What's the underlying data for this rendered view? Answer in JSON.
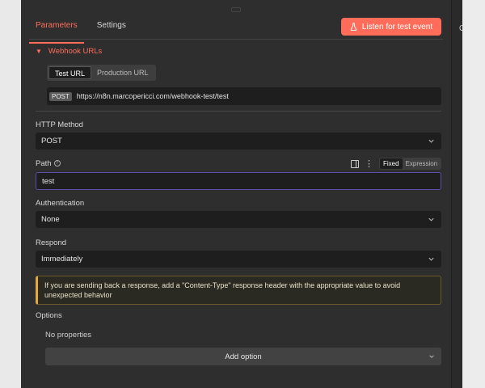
{
  "tabs": [
    "Parameters",
    "Settings"
  ],
  "listen_button": "Listen for test event",
  "webhook": {
    "section_label": "Webhook URLs",
    "url_tabs": [
      "Test URL",
      "Production URL"
    ],
    "method": "POST",
    "url": "https://n8n.marcopericci.com/webhook-test/test"
  },
  "http_method": {
    "label": "HTTP Method",
    "value": "POST"
  },
  "path": {
    "label": "Path",
    "value": "test",
    "modes": [
      "Fixed",
      "Expression"
    ]
  },
  "authentication": {
    "label": "Authentication",
    "value": "None"
  },
  "respond": {
    "label": "Respond",
    "value": "Immediately"
  },
  "notice": "If you are sending back a response, add a \"Content-Type\" response header with the appropriate value to avoid unexpected behavior",
  "options": {
    "label": "Options",
    "empty_text": "No properties",
    "add_button": "Add option"
  },
  "right_panel_letter": "O",
  "colors": {
    "accent": "#ff6d5a",
    "warning": "#e3a93b",
    "panel": "#2e2e2e"
  }
}
